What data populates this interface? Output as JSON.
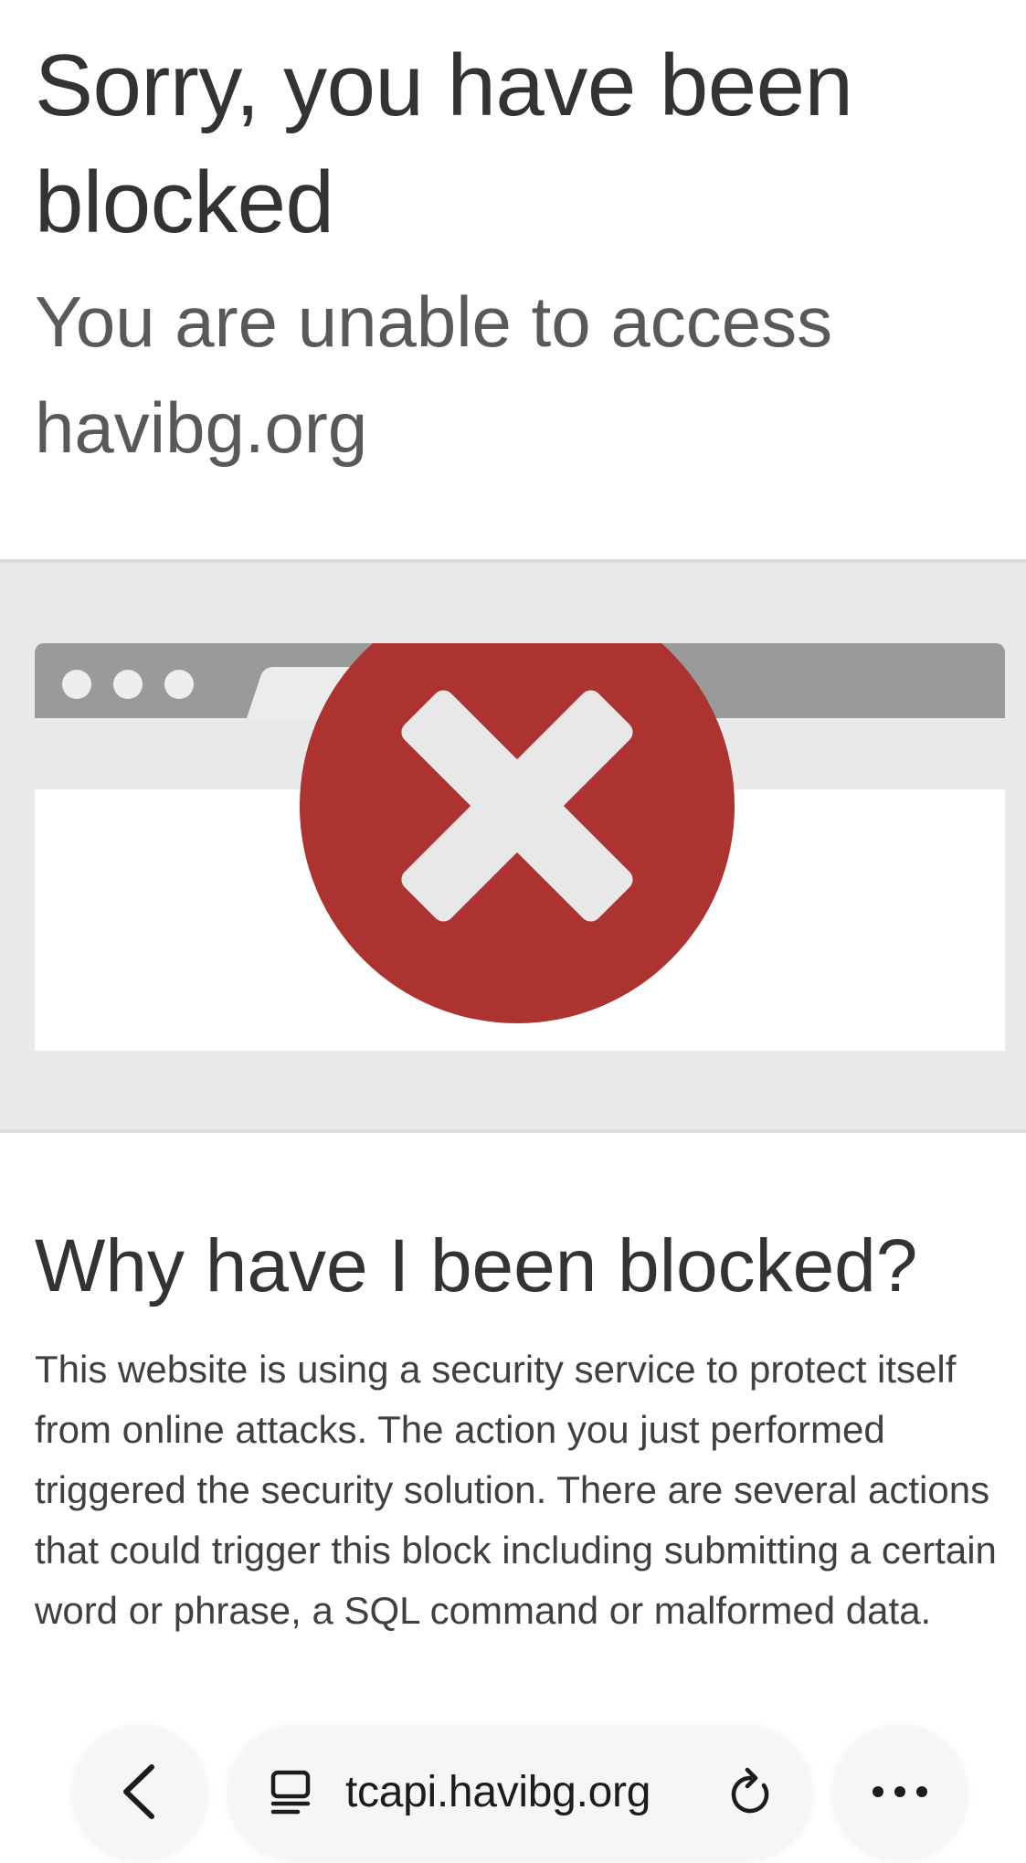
{
  "header": {
    "title": "Sorry, you have been blocked",
    "subtitle": "You are unable to access havibg.org"
  },
  "banner": {
    "graphic_icon": "blocked-browser-x-icon",
    "colors": {
      "background": "#e9e9e9",
      "tab_bar": "#9a9a9a",
      "error_circle": "#ac3330",
      "x_mark": "#e8e8e8"
    }
  },
  "explanation": {
    "heading": "Why have I been blocked?",
    "body": "This website is using a security service to protect itself from online attacks. The action you just performed triggered the security solution. There are several actions that could trigger this block including submitting a certain word or phrase, a SQL command or malformed data."
  },
  "browser_toolbar": {
    "url": "tcapi.havibg.org",
    "back_icon": "chevron-left-icon",
    "page_icon": "reader-icon",
    "reload_icon": "reload-icon",
    "more_icon": "ellipsis-icon"
  }
}
